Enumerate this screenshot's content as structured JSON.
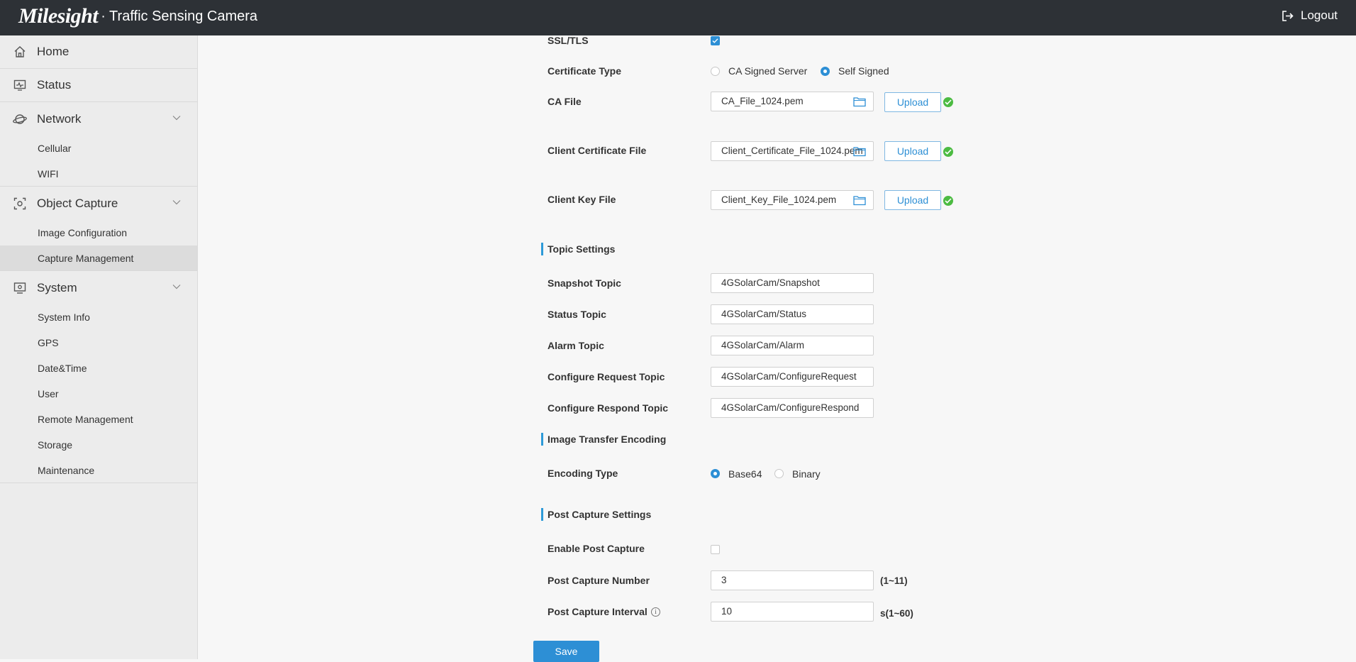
{
  "header": {
    "logo_text": "Milesight",
    "product": "· Traffic Sensing Camera",
    "logout": "Logout"
  },
  "sidebar": {
    "home": "Home",
    "status": "Status",
    "network": "Network",
    "network_items": [
      "Cellular",
      "WIFI"
    ],
    "object_capture": "Object Capture",
    "object_capture_items": [
      "Image Configuration",
      "Capture Management"
    ],
    "system": "System",
    "system_items": [
      "System Info",
      "GPS",
      "Date&Time",
      "User",
      "Remote Management",
      "Storage",
      "Maintenance"
    ]
  },
  "form": {
    "ssl_label": "SSL/TLS",
    "ssl_checked": true,
    "cert_type_label": "Certificate Type",
    "cert_type_options": [
      "CA Signed Server",
      "Self Signed"
    ],
    "cert_type_selected": "Self Signed",
    "ca_file_label": "CA File",
    "ca_file_value": "CA_File_1024.pem",
    "client_cert_label": "Client Certificate File",
    "client_cert_value": "Client_Certificate_File_1024.pem",
    "client_key_label": "Client Key File",
    "client_key_value": "Client_Key_File_1024.pem",
    "upload_label": "Upload",
    "topic_section": "Topic Settings",
    "snapshot_topic_label": "Snapshot Topic",
    "snapshot_topic_value": "4GSolarCam/Snapshot",
    "status_topic_label": "Status Topic",
    "status_topic_value": "4GSolarCam/Status",
    "alarm_topic_label": "Alarm Topic",
    "alarm_topic_value": "4GSolarCam/Alarm",
    "config_request_label": "Configure Request Topic",
    "config_request_value": "4GSolarCam/ConfigureRequest",
    "config_respond_label": "Configure Respond Topic",
    "config_respond_value": "4GSolarCam/ConfigureRespond",
    "encoding_section": "Image Transfer Encoding",
    "encoding_type_label": "Encoding Type",
    "encoding_options": [
      "Base64",
      "Binary"
    ],
    "encoding_selected": "Base64",
    "post_capture_section": "Post Capture Settings",
    "enable_post_capture_label": "Enable Post Capture",
    "enable_post_capture_checked": false,
    "post_capture_number_label": "Post Capture Number",
    "post_capture_number_value": "3",
    "post_capture_number_hint": "(1~11)",
    "post_capture_interval_label": "Post Capture Interval",
    "post_capture_interval_value": "10",
    "post_capture_interval_hint": "s(1~60)",
    "info_glyph": "i",
    "save_label": "Save"
  },
  "colors": {
    "topbar": "#2d3136",
    "accent": "#2d8fd5",
    "success": "#4cbb42",
    "sidebar_bg": "#ececec"
  }
}
